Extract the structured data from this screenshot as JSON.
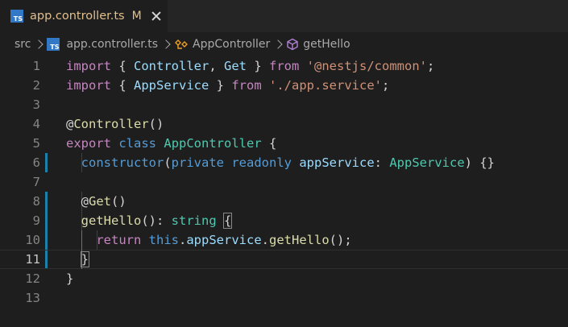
{
  "tab": {
    "icon_label": "TS",
    "title": "app.controller.ts",
    "modified": "M"
  },
  "breadcrumb": {
    "folder": "src",
    "file": "app.controller.ts",
    "class_name": "AppController",
    "method_name": "getHello"
  },
  "colors": {
    "keyword": "#569cd6",
    "control": "#c586c0",
    "string": "#ce9178",
    "type": "#4ec9b0",
    "function": "#dcdcaa",
    "variable": "#9cdcfe",
    "modified_tab": "#e2c08d",
    "change_bar": "#1b81a8"
  },
  "editor": {
    "current_line": 11,
    "lines": [
      {
        "n": "1",
        "tokens": [
          [
            "ctl",
            "import"
          ],
          [
            "pun",
            " { "
          ],
          [
            "var",
            "Controller"
          ],
          [
            "pun",
            ", "
          ],
          [
            "var",
            "Get"
          ],
          [
            "pun",
            " } "
          ],
          [
            "ctl",
            "from"
          ],
          [
            "pun",
            " "
          ],
          [
            "str",
            "'@nestjs/common'"
          ],
          [
            "pun",
            ";"
          ]
        ]
      },
      {
        "n": "2",
        "tokens": [
          [
            "ctl",
            "import"
          ],
          [
            "pun",
            " { "
          ],
          [
            "var",
            "AppService"
          ],
          [
            "pun",
            " } "
          ],
          [
            "ctl",
            "from"
          ],
          [
            "pun",
            " "
          ],
          [
            "str",
            "'./app.service'"
          ],
          [
            "pun",
            ";"
          ]
        ]
      },
      {
        "n": "3",
        "tokens": []
      },
      {
        "n": "4",
        "tokens": [
          [
            "pun",
            "@"
          ],
          [
            "fn",
            "Controller"
          ],
          [
            "pun",
            "()"
          ]
        ]
      },
      {
        "n": "5",
        "tokens": [
          [
            "ctl",
            "export"
          ],
          [
            "pun",
            " "
          ],
          [
            "kw",
            "class"
          ],
          [
            "pun",
            " "
          ],
          [
            "cls",
            "AppController"
          ],
          [
            "pun",
            " {"
          ]
        ]
      },
      {
        "n": "6",
        "tokens": [
          [
            "pun",
            "  "
          ],
          [
            "kw",
            "constructor"
          ],
          [
            "pun",
            "("
          ],
          [
            "kw",
            "private"
          ],
          [
            "pun",
            " "
          ],
          [
            "kw",
            "readonly"
          ],
          [
            "pun",
            " "
          ],
          [
            "var",
            "appService"
          ],
          [
            "pun",
            ": "
          ],
          [
            "cls",
            "AppService"
          ],
          [
            "pun",
            ") {}"
          ]
        ]
      },
      {
        "n": "7",
        "tokens": []
      },
      {
        "n": "8",
        "tokens": [
          [
            "pun",
            "  @"
          ],
          [
            "fn",
            "Get"
          ],
          [
            "pun",
            "()"
          ]
        ]
      },
      {
        "n": "9",
        "tokens": [
          [
            "pun",
            "  "
          ],
          [
            "fn",
            "getHello"
          ],
          [
            "pun",
            "(): "
          ],
          [
            "cls",
            "string"
          ],
          [
            "pun",
            " "
          ],
          [
            "bm",
            "{"
          ]
        ]
      },
      {
        "n": "10",
        "tokens": [
          [
            "pun",
            "    "
          ],
          [
            "ctl",
            "return"
          ],
          [
            "pun",
            " "
          ],
          [
            "kw",
            "this"
          ],
          [
            "pun",
            "."
          ],
          [
            "var",
            "appService"
          ],
          [
            "pun",
            "."
          ],
          [
            "fn",
            "getHello"
          ],
          [
            "pun",
            "();"
          ]
        ]
      },
      {
        "n": "11",
        "tokens": [
          [
            "pun",
            "  "
          ],
          [
            "bm",
            "}"
          ]
        ]
      },
      {
        "n": "12",
        "tokens": [
          [
            "pun",
            "}"
          ]
        ]
      },
      {
        "n": "13",
        "tokens": []
      }
    ]
  }
}
